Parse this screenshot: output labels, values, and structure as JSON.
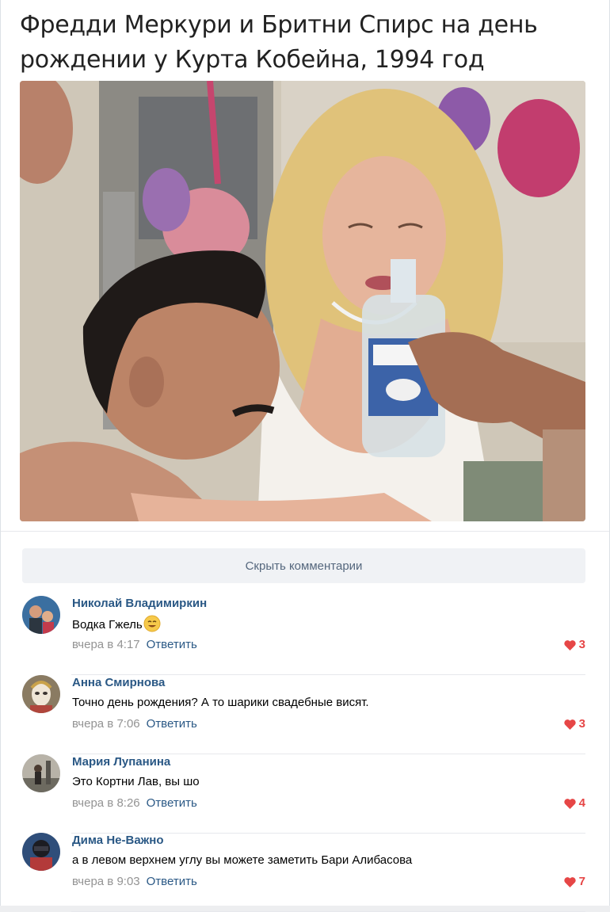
{
  "post": {
    "title_line1": "Фредди Меркури и Бритни Спирс на день",
    "title_line2": "рождении у Курта Кобейна, 1994 год"
  },
  "comments_toggle": {
    "label": "Скрыть комментарии"
  },
  "comments": [
    {
      "author": "Николай Владимиркин",
      "text": "Водка Гжель",
      "emoji": "smiling-face-emoji",
      "time": "вчера в 4:17",
      "reply_label": "Ответить",
      "likes": "3"
    },
    {
      "author": "Анна Смирнова",
      "text": "Точно день рождения? А то шарики свадебные висят.",
      "time": "вчера в 7:06",
      "reply_label": "Ответить",
      "likes": "3"
    },
    {
      "author": "Мария Лупанина",
      "text": "Это Кортни Лав, вы шо",
      "time": "вчера в 8:26",
      "reply_label": "Ответить",
      "likes": "4"
    },
    {
      "author": "Дима Не-Важно",
      "text": "а в левом верхнем углу вы можете заметить Бари Алибасова",
      "time": "вчера в 9:03",
      "reply_label": "Ответить",
      "likes": "7"
    }
  ],
  "colors": {
    "link": "#2a5885",
    "like": "#e64646",
    "meta": "#939393",
    "button_bg": "#f0f2f5"
  }
}
